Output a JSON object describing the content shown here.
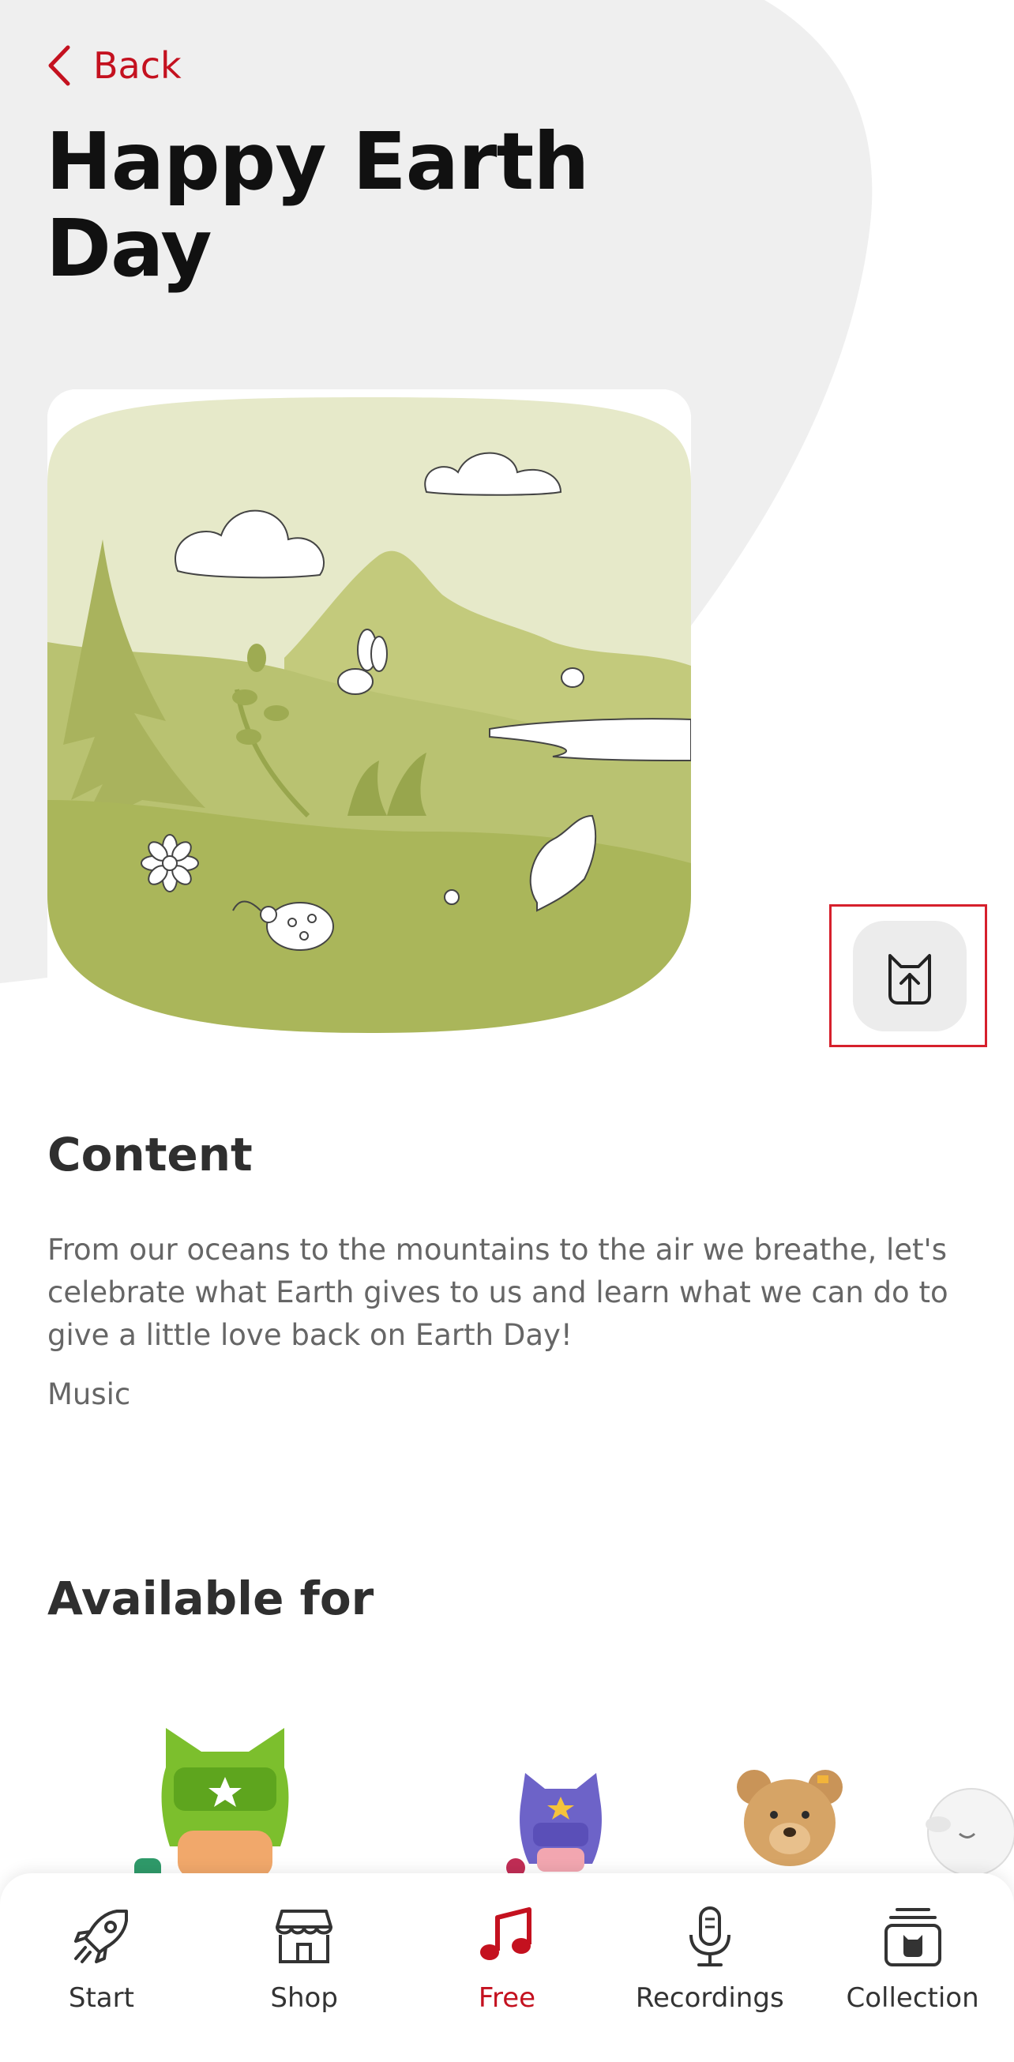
{
  "header": {
    "back_label": "Back",
    "title": "Happy Earth Day"
  },
  "colors": {
    "accent": "#c4111f",
    "background_blob": "#efefef",
    "cover_green": "#b5c06b",
    "highlight": "#d6202c"
  },
  "cover": {
    "icon": "earth-day-landscape-illustration"
  },
  "tonie_button": {
    "icon": "tonie-upload-icon"
  },
  "content": {
    "heading": "Content",
    "description": "From our oceans to the mountains to the air we breathe, let's celebrate what Earth gives to us and learn what we can do to give a little love back on Earth Day!",
    "genre": "Music"
  },
  "available": {
    "heading": "Available for",
    "figures": [
      {
        "icon": "green-hero-tonie-icon"
      },
      {
        "icon": "purple-hero-tonie-icon"
      },
      {
        "icon": "teddy-bear-tonie-icon"
      },
      {
        "icon": "lamb-tonie-icon"
      }
    ]
  },
  "bottom_nav": {
    "items": [
      {
        "label": "Start",
        "icon": "rocket-icon",
        "active": false
      },
      {
        "label": "Shop",
        "icon": "store-icon",
        "active": false
      },
      {
        "label": "Free",
        "icon": "music-note-icon",
        "active": true
      },
      {
        "label": "Recordings",
        "icon": "microphone-icon",
        "active": false
      },
      {
        "label": "Collection",
        "icon": "collection-icon",
        "active": false
      }
    ]
  }
}
